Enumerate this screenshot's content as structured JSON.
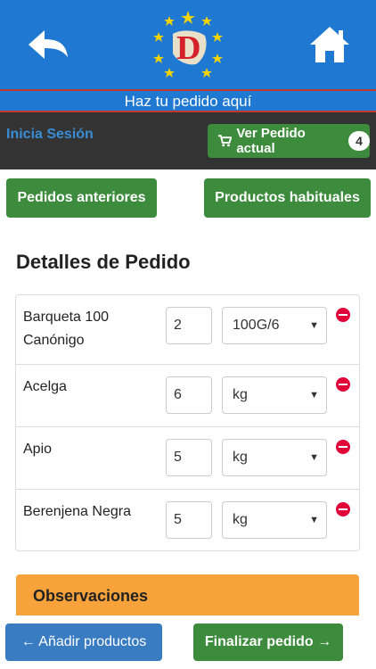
{
  "header": {
    "tagline": "Haz tu pedido aquí",
    "logo_letter": "D",
    "colors": {
      "bar": "#1f78d1",
      "accent_line": "#c0392b"
    }
  },
  "top_bar": {
    "login_label": "Inicia Sesión",
    "cart_label": "Ver Pedido actual",
    "cart_count": "4"
  },
  "actions": {
    "previous_orders": "Pedidos anteriores",
    "usual_products": "Productos habituales"
  },
  "section_title": "Detalles de Pedido",
  "order_items": [
    {
      "name": "Barqueta 100 Canónigo",
      "qty": "2",
      "unit": "100G/6"
    },
    {
      "name": "Acelga",
      "qty": "6",
      "unit": "kg"
    },
    {
      "name": "Apio",
      "qty": "5",
      "unit": "kg"
    },
    {
      "name": "Berenjena Negra",
      "qty": "5",
      "unit": "kg"
    }
  ],
  "observations_title": "Observaciones",
  "footer": {
    "add_products": "← Añadir productos",
    "finish_order": "Finalizar pedido →"
  },
  "icons": {
    "back": "back-arrow-icon",
    "home": "home-icon",
    "cart": "cart-icon",
    "remove": "remove-icon"
  },
  "colors": {
    "green": "#3d8b3d",
    "blue_button": "#3a7cc2",
    "orange_panel": "#f7a23a",
    "dark_bar": "#333333",
    "remove_red": "#e0003a"
  }
}
